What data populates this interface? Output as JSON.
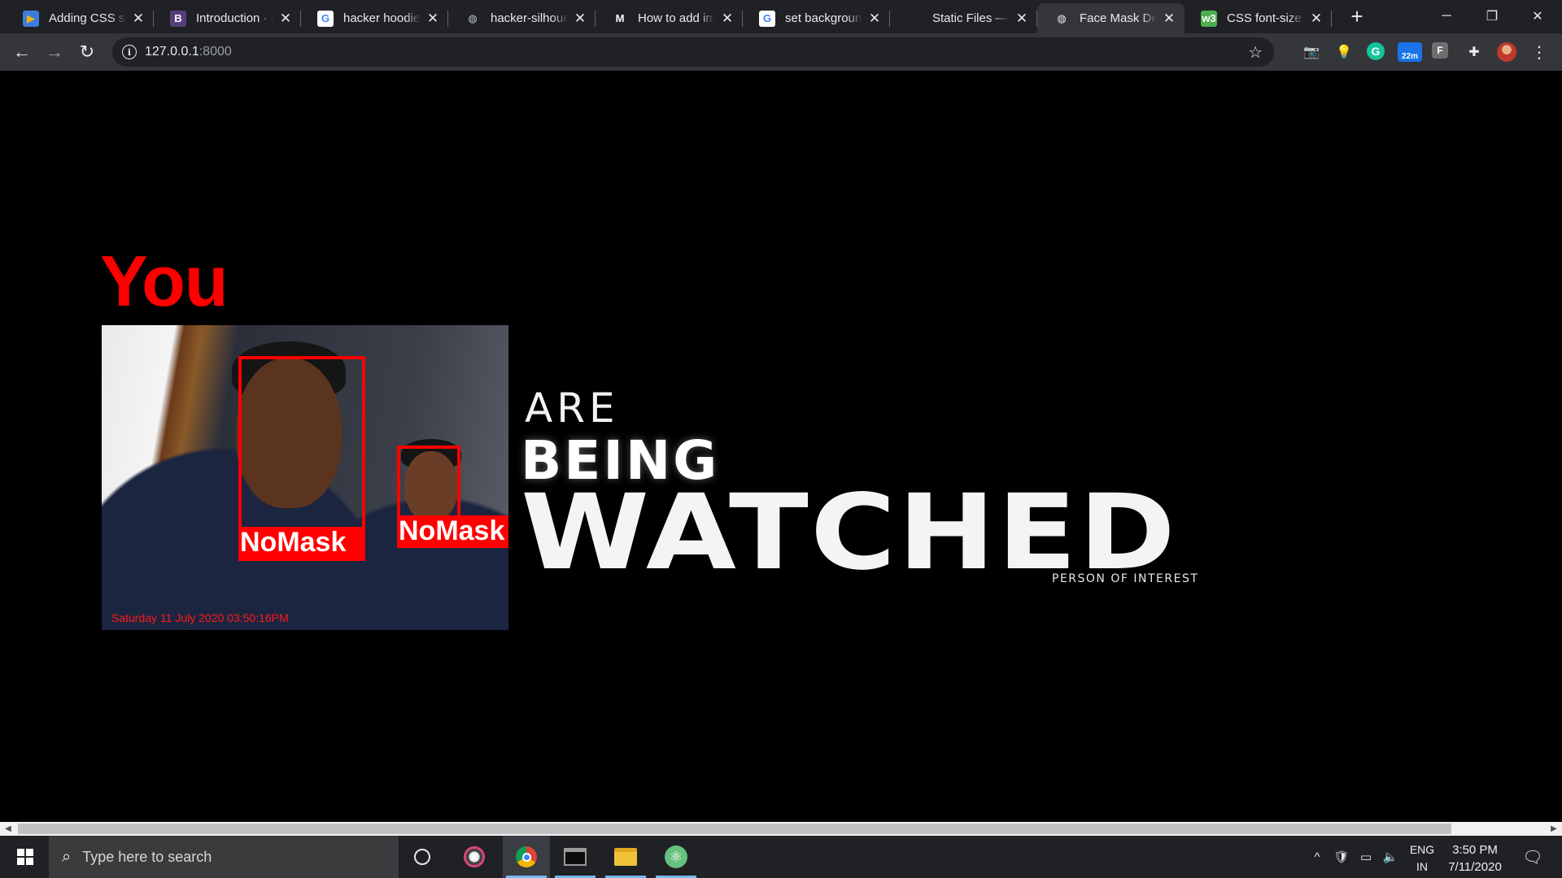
{
  "browser": {
    "tabs": [
      {
        "label": "Adding CSS style",
        "icon": "bootstrap-icon",
        "fav_text": "▶",
        "fav_bg": "#3b7ddd",
        "fav_color": "#f5b400",
        "active": false
      },
      {
        "label": "Introduction · Bootstrap",
        "icon": "bootstrap-icon",
        "fav_text": "B",
        "fav_bg": "#563d7c",
        "fav_color": "#ffffff",
        "active": false
      },
      {
        "label": "hacker hoodie",
        "icon": "google-icon",
        "fav_text": "G",
        "fav_bg": "#ffffff",
        "fav_color": "#4285f4",
        "active": false
      },
      {
        "label": "hacker-silhouette",
        "icon": "globe-icon",
        "fav_text": "◍",
        "fav_bg": "transparent",
        "fav_color": "#bdc1c6",
        "active": false
      },
      {
        "label": "How to add images",
        "icon": "medium-icon",
        "fav_text": "M",
        "fav_bg": "transparent",
        "fav_color": "#ffffff",
        "active": false
      },
      {
        "label": "set background",
        "icon": "google-icon",
        "fav_text": "G",
        "fav_bg": "#ffffff",
        "fav_color": "#4285f4",
        "active": false
      },
      {
        "label": "Static Files — Flask",
        "icon": "flask-icon",
        "fav_text": "",
        "fav_bg": "transparent",
        "fav_color": "#ffffff",
        "active": false
      },
      {
        "label": "Face Mask Detection",
        "icon": "globe-icon",
        "fav_text": "◍",
        "fav_bg": "transparent",
        "fav_color": "#e8eaed",
        "active": true
      },
      {
        "label": "CSS font-size property",
        "icon": "w3schools-icon",
        "fav_text": "w3",
        "fav_bg": "#4caf50",
        "fav_color": "#ffffff",
        "active": false
      }
    ],
    "new_tab": "+",
    "window_controls": {
      "minimize": "─",
      "restore": "❐",
      "close": "✕"
    },
    "nav": {
      "back": "←",
      "forward": "→",
      "reload": "↻"
    },
    "address": {
      "host": "127.0.0.1",
      "port": ":8000",
      "info": "i",
      "star": "☆"
    },
    "extensions": {
      "camera": "📷",
      "bulb": "💡",
      "grammarly": "G",
      "badge_text": "22m",
      "fn": "F",
      "puzzle": "✚",
      "menu": "⋮"
    }
  },
  "page": {
    "headline_you": "You",
    "camera": {
      "labels": [
        "NoMask",
        "NoMask"
      ],
      "timestamp": "Saturday  11  July  2020  03:50:16PM"
    },
    "tagline": {
      "are": "ARE",
      "being": "BEING",
      "watched": "WATCHED",
      "poi": "PERSON OF INTEREST"
    },
    "colors": {
      "headline": "#ff0000",
      "box": "#ff0000",
      "background": "#000000"
    }
  },
  "scrollbar": {
    "left": "◀",
    "right": "▶"
  },
  "taskbar": {
    "search_placeholder": "Type here to search",
    "tray": {
      "chevron": "^",
      "language_top": "ENG",
      "language_bottom": "IN"
    },
    "clock": {
      "time": "3:50 PM",
      "date": "7/11/2020"
    }
  }
}
